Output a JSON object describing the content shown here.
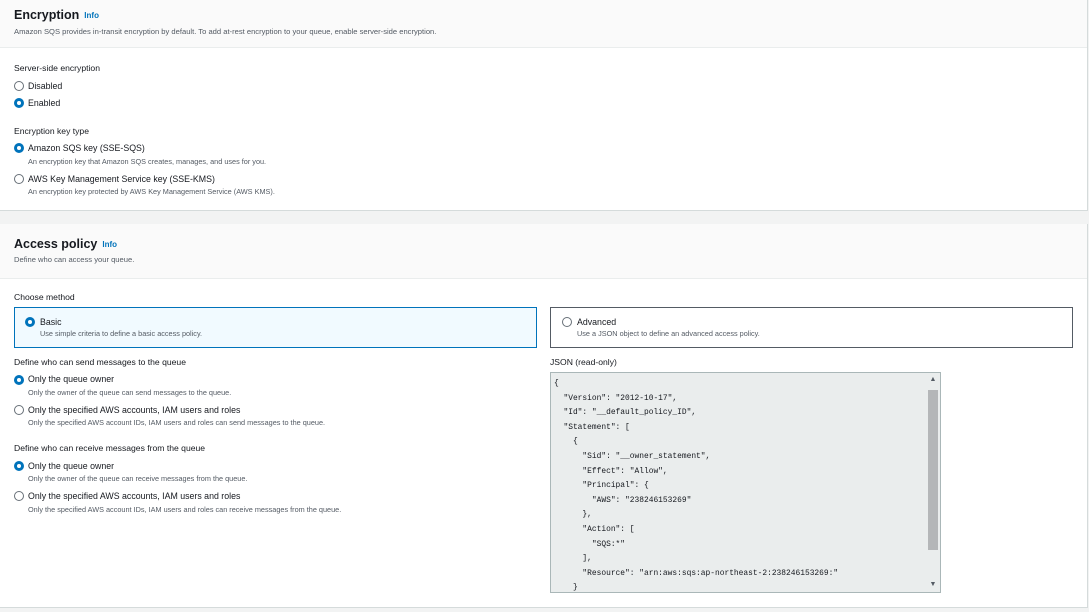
{
  "encryption": {
    "title": "Encryption",
    "info": "Info",
    "description": "Amazon SQS provides in-transit encryption by default. To add at-rest encryption to your queue, enable server-side encryption.",
    "sse_label": "Server-side encryption",
    "sse_options": [
      {
        "label": "Disabled",
        "selected": false
      },
      {
        "label": "Enabled",
        "selected": true
      }
    ],
    "key_type_label": "Encryption key type",
    "key_options": [
      {
        "label": "Amazon SQS key (SSE-SQS)",
        "sub": "An encryption key that Amazon SQS creates, manages, and uses for you.",
        "selected": true
      },
      {
        "label": "AWS Key Management Service key (SSE-KMS)",
        "sub": "An encryption key protected by AWS Key Management Service (AWS KMS).",
        "selected": false
      }
    ]
  },
  "access_policy": {
    "title": "Access policy",
    "info": "Info",
    "description": "Define who can access your queue.",
    "method_label": "Choose method",
    "methods": [
      {
        "label": "Basic",
        "sub": "Use simple criteria to define a basic access policy.",
        "selected": true
      },
      {
        "label": "Advanced",
        "sub": "Use a JSON object to define an advanced access policy.",
        "selected": false
      }
    ],
    "send_label": "Define who can send messages to the queue",
    "send_options": [
      {
        "label": "Only the queue owner",
        "sub": "Only the owner of the queue can send messages to the queue.",
        "selected": true
      },
      {
        "label": "Only the specified AWS accounts, IAM users and roles",
        "sub": "Only the specified AWS account IDs, IAM users and roles can send messages to the queue.",
        "selected": false
      }
    ],
    "receive_label": "Define who can receive messages from the queue",
    "receive_options": [
      {
        "label": "Only the queue owner",
        "sub": "Only the owner of the queue can receive messages from the queue.",
        "selected": true
      },
      {
        "label": "Only the specified AWS accounts, IAM users and roles",
        "sub": "Only the specified AWS account IDs, IAM users and roles can receive messages from the queue.",
        "selected": false
      }
    ],
    "json_label": "JSON (read-only)",
    "json_text": "{\n  \"Version\": \"2012-10-17\",\n  \"Id\": \"__default_policy_ID\",\n  \"Statement\": [\n    {\n      \"Sid\": \"__owner_statement\",\n      \"Effect\": \"Allow\",\n      \"Principal\": {\n        \"AWS\": \"238246153269\"\n      },\n      \"Action\": [\n        \"SQS:*\"\n      ],\n      \"Resource\": \"arn:aws:sqs:ap-northeast-2:238246153269:\"\n    }"
  }
}
